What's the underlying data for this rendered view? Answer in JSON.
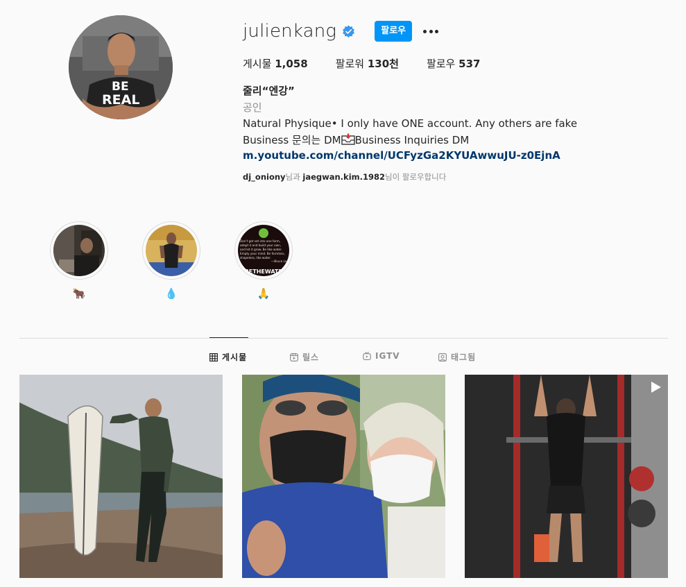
{
  "profile": {
    "username": "julienkang",
    "verified": true,
    "follow_label": "팔로우",
    "stats": {
      "posts_label": "게시물",
      "posts_value": "1,058",
      "followers_label": "팔로워",
      "followers_value": "130천",
      "following_label": "팔로우",
      "following_value": "537"
    },
    "full_name": "줄리“엔강”",
    "category": "공인",
    "bio_line1": "Natural Physique• I only have ONE account. Any others are fake",
    "bio_line2_a": "Business 문의는 DM",
    "bio_line2_b": "Business Inquiries DM",
    "link": "m.youtube.com/channel/UCFyzGa2KYUAwwuJU-z0EjnA",
    "followed_by": {
      "user1": "dj_oniony",
      "mid": "님과 ",
      "user2": "jaegwan.kim.1982",
      "tail": "님이 팔로우합니다"
    }
  },
  "highlights": [
    {
      "label": "🐂"
    },
    {
      "label": "💧"
    },
    {
      "label": "🙏"
    }
  ],
  "highlight_3_text": [
    "Don't get set into one form,",
    "adapt it and build your own,",
    "and let it grow. Be like water.",
    "Empty your mind. Be formless,",
    "shapeless, like water.",
    "—Bruce Lee",
    "#BETHEWATER"
  ],
  "avatar_shirt_text": [
    "BE",
    "REAL"
  ],
  "tabs": [
    {
      "label": "게시물",
      "icon": "grid-icon",
      "active": true
    },
    {
      "label": "릴스",
      "icon": "reels-icon",
      "active": false
    },
    {
      "label": "IGTV",
      "icon": "igtv-icon",
      "active": false
    },
    {
      "label": "태그됨",
      "icon": "tagged-icon",
      "active": false
    }
  ],
  "posts": [
    {
      "description_icon": "photo"
    },
    {
      "description_icon": "photo"
    },
    {
      "description_icon": "reel-play-icon"
    }
  ],
  "colors": {
    "accent": "#0095f6",
    "link": "#00376b",
    "muted": "#8e8e8e",
    "text": "#262626",
    "background": "#fafafa",
    "verified": "#3897f0"
  }
}
